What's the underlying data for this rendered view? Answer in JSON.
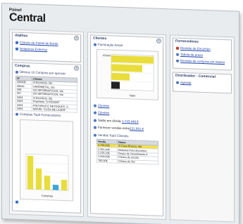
{
  "app": {
    "logo_line1": "Painel",
    "logo_line2": "Central"
  },
  "atalhos": {
    "title": "Atalhos",
    "links": [
      "Cálculo do Painel de Bordo",
      "Relatórios Externos"
    ]
  },
  "compras": {
    "title": "Compras",
    "list_title": "Últimos 10 Compras por aprovar",
    "columns": [
      "Nº",
      "Cliente"
    ],
    "rows": [
      [
        "258408",
        "O Escritório, Ida"
      ],
      [
        "46644",
        "HARDMETAL, Ida"
      ],
      [
        "396",
        "OS INFORMATICOS, Ida"
      ],
      [
        "357",
        "OS INFORMATICOS, Ida"
      ],
      [
        "3404",
        "O Escritório, Ida"
      ],
      [
        "3404",
        "Papelaria \"A POSSIM\""
      ],
      [
        "3404",
        "PINTURAS E RETOQUES, S"
      ],
      [
        "3404",
        "MOVEL \"CASA DE LAZER\""
      ]
    ],
    "chart_title": "Compras Top5 Fornecedores",
    "chart_xlabel": "Compras"
  },
  "clientes": {
    "title": "Clientes",
    "chart_title": "Facturação Anual",
    "chart_xlabel": "Valor",
    "chart_ytick_top": "150000",
    "links": [
      "Clientes",
      "Clientes"
    ],
    "saldo_label": "Saldo em dívida:",
    "saldo_value": "1.743.446 €",
    "fornec_label": "Fornecer vendas entre:",
    "fornec_value": "131.991 €",
    "top_title": "Vendas Top5 Clientes",
    "top_columns": [
      "Venda",
      "Nome"
    ],
    "top_rows": [
      [
        "3.756,82€",
        "O Casa Branca, Ida"
      ],
      [
        "2.391,44€",
        "Modulos Para Escritório"
      ],
      [
        "2.235,33€",
        "Grupo de investimento A"
      ],
      [
        "1.200,00€",
        "Clínica de escola"
      ],
      [
        "780,00€",
        "Clínica do Sol"
      ]
    ]
  },
  "fornecedores": {
    "title": "Fornecedores",
    "links": [
      "Revisão de Encomen",
      "Tabela de prazo",
      "Revisão de compras em massa"
    ]
  },
  "distribuidor": {
    "title": "Distribuidor - Comercial",
    "links": [
      "Agenda"
    ]
  },
  "chart_data": [
    {
      "type": "bar",
      "title": "Facturação Anual",
      "xlabel": "Valor",
      "ylim": [
        0,
        150000
      ],
      "categories": [
        "",
        "",
        "",
        ""
      ],
      "series": [
        {
          "values": [
            150000,
            110000,
            65000,
            30000
          ]
        }
      ],
      "colors": {
        "bar": "#e9dd3c",
        "highlight": "#222222"
      }
    },
    {
      "type": "bar",
      "title": "Compras Top5 Fornecedores",
      "xlabel": "Compras",
      "categories": [
        "",
        "",
        "",
        "",
        ""
      ],
      "series": [
        {
          "values": [
            95,
            60,
            40,
            15,
            30
          ]
        }
      ],
      "colors": {
        "bar": "#e9dd3c",
        "alt": "#3aa7d8"
      }
    }
  ]
}
